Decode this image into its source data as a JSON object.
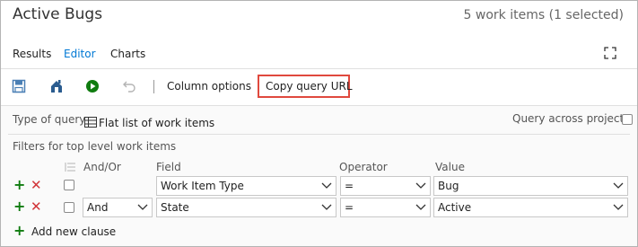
{
  "header": {
    "title": "Active Bugs",
    "count": "5 work items (1 selected)"
  },
  "tabs": [
    {
      "label": "Results"
    },
    {
      "label": "Editor"
    },
    {
      "label": "Charts"
    }
  ],
  "toolbar": {
    "column_options": "Column options",
    "copy_query_url": "Copy query URL"
  },
  "query": {
    "type_label": "Type of query",
    "type_value": "Flat list of work items",
    "across_projects": "Query across projects",
    "filters_label": "Filters for top level work items"
  },
  "columns": {
    "andor": "And/Or",
    "field": "Field",
    "operator": "Operator",
    "value": "Value"
  },
  "clauses": [
    {
      "andor": "",
      "field": "Work Item Type",
      "operator": "=",
      "value": "Bug"
    },
    {
      "andor": "And",
      "field": "State",
      "operator": "=",
      "value": "Active"
    }
  ],
  "add_clause": "Add new clause",
  "colors": {
    "accent": "#0078d4",
    "highlight": "#e0493e",
    "add": "#107c10",
    "delete": "#d13438"
  }
}
